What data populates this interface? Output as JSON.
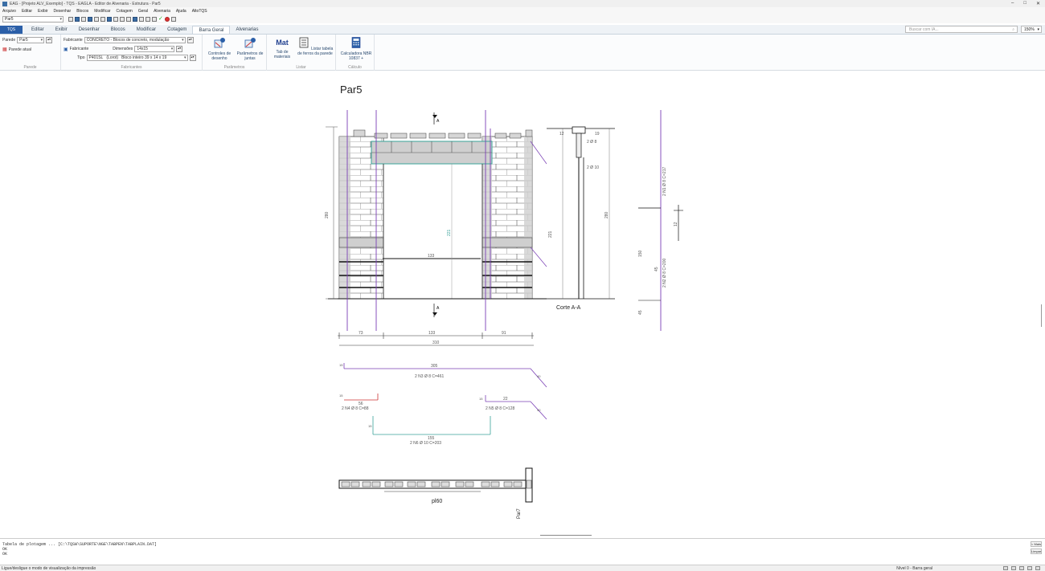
{
  "window": {
    "title": "EAG - [Projeto ALV_Exemplo] - TQS - EAGLA - Editor de Alvenaria - Estrutura - Par5",
    "minimize": "–",
    "maximize": "□",
    "close": "✕"
  },
  "menu": [
    "Arquivo",
    "Editar",
    "Exibir",
    "Desenhar",
    "Blocos",
    "Modificar",
    "Cotagem",
    "Geral",
    "Alvenaria",
    "Ajuda",
    "AltoTQS"
  ],
  "qat": {
    "layer_value": "Par5"
  },
  "tabs": {
    "file": "TQS",
    "items": [
      "Editar",
      "Exibir",
      "Desenhar",
      "Blocos",
      "Modificar",
      "Cotagem",
      "Barra Geral",
      "Alvenarias"
    ],
    "active_index": 6
  },
  "search": {
    "placeholder": "Buscar com IA..."
  },
  "zoom": {
    "value": "150%"
  },
  "ribbon": {
    "parede": {
      "label": "Parede",
      "value": "Par5",
      "new_button": "Parede atual",
      "group": "Parede"
    },
    "fabricante": {
      "fab_label": "Fabricante",
      "fab_value": "CONCRETO - Blocos de concreto, modulação",
      "lab_label": "Fabricante",
      "dim_label": "Dimensões",
      "dim_value": "14x15",
      "tipo_label": "Tipo",
      "tipo_value": "P401SL",
      "tipo_code": "(Lorot)",
      "tipo_desc": "Bloco inteiro 39 x 14 x 19",
      "group": "Fabricantes"
    },
    "parametros": {
      "btn1": "Controles de desenho",
      "btn2": "Parâmetros de juntas",
      "group": "Parâmetros"
    },
    "listar": {
      "mat_icon": "Mat",
      "btn1": "Tab de materiais",
      "btn2": "Listar tabela de ferros da parede",
      "group": "Listar"
    },
    "calculo": {
      "btn1": "Calculadora NBR 10837 +",
      "group": "Cálculo"
    }
  },
  "drawing": {
    "wall_title": "Par5",
    "section_label": "Corte A-A",
    "plan_label": "pl60",
    "wall_ref": "Par7",
    "cut_mark": "A",
    "height_main": "280",
    "height_door": "221",
    "height_lintel": "221",
    "height_right": "280",
    "width_left": "73",
    "width_door": "133",
    "width_right": "91",
    "width_total": "310",
    "lintel_width": "133",
    "top_band": "12",
    "top_depth": "19",
    "beam_detail": "2 Ø 8",
    "beam_len": "2 Ø 10",
    "bar_vert_right1": "2 N1 Ø 8 C=217",
    "bar_vert_right2": "2 N2 Ø 8 C=200",
    "bar_right_dim1": "150",
    "bar_right_dim2": "45",
    "bar_right_dim3": "45",
    "bar_right_dim4": "12",
    "bar1_len": "305",
    "bar1_label": "2 N3 Ø 8 C=461",
    "bar1_hook": "15",
    "bar1_end": "40",
    "bar2_len": "56",
    "bar2_label": "2 N4 Ø 8 C=88",
    "bar2_hook": "15",
    "bar3_len": "22",
    "bar3_label": "2 N5 Ø 8 C=128",
    "bar3_hook": "15",
    "bar3_end": "40",
    "bar4_len": "155",
    "bar4_label": "2 N6 Ø 10 C=203",
    "bar4_hook": "15"
  },
  "command": {
    "line1": "Tabela de plotagem ... [C:\\TQSW\\SUPORTE\\NGE\\TABPEN\\TABPLAIN.DAT]",
    "line2": "OK",
    "line3": "OK",
    "btn1": "< Mais",
    "btn2": "Limpar"
  },
  "status": {
    "left": "Ligue/desligue o modo de visualização da impressão",
    "right": "Nível 0 - Barra geral"
  },
  "colors": {
    "grid_purple": "#7a3fb5",
    "wall_gray": "#c8c8c8",
    "lintel_teal": "#3aa39a",
    "accent_blue": "#2b5fa8"
  }
}
